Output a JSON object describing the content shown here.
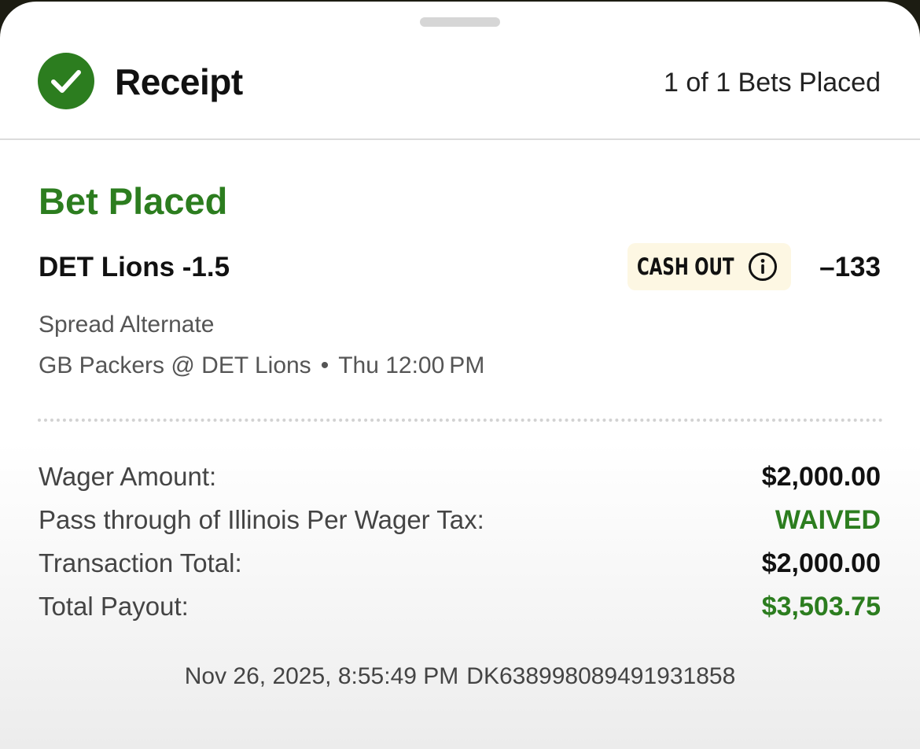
{
  "header": {
    "title": "Receipt",
    "bets_placed": "1 of 1 Bets Placed",
    "status_icon": "checkmark-circle-icon"
  },
  "bet": {
    "status": "Bet Placed",
    "selection": "DET Lions -1.5",
    "cash_out_label": "CASH OUT",
    "cash_out_icon": "info-icon",
    "odds": "–133",
    "market": "Spread Alternate",
    "matchup": "GB Packers @ DET Lions",
    "separator": "•",
    "game_time": "Thu 12:00 PM"
  },
  "summary": [
    {
      "label": "Wager Amount:",
      "value": "$2,000.00"
    },
    {
      "label": "Pass through of Illinois Per Wager Tax:",
      "value": "WAIVED"
    },
    {
      "label": "Transaction Total:",
      "value": "$2,000.00"
    },
    {
      "label": "Total Payout:",
      "value": "$3,503.75"
    }
  ],
  "footer": {
    "timestamp": "Nov 26, 2025, 8:55:49 PM",
    "bet_id": "DK638998089491931858"
  },
  "colors": {
    "accent_green": "#2c7d1f",
    "cash_out_bg": "#fdf7e3",
    "divider": "#d2d2d2"
  }
}
